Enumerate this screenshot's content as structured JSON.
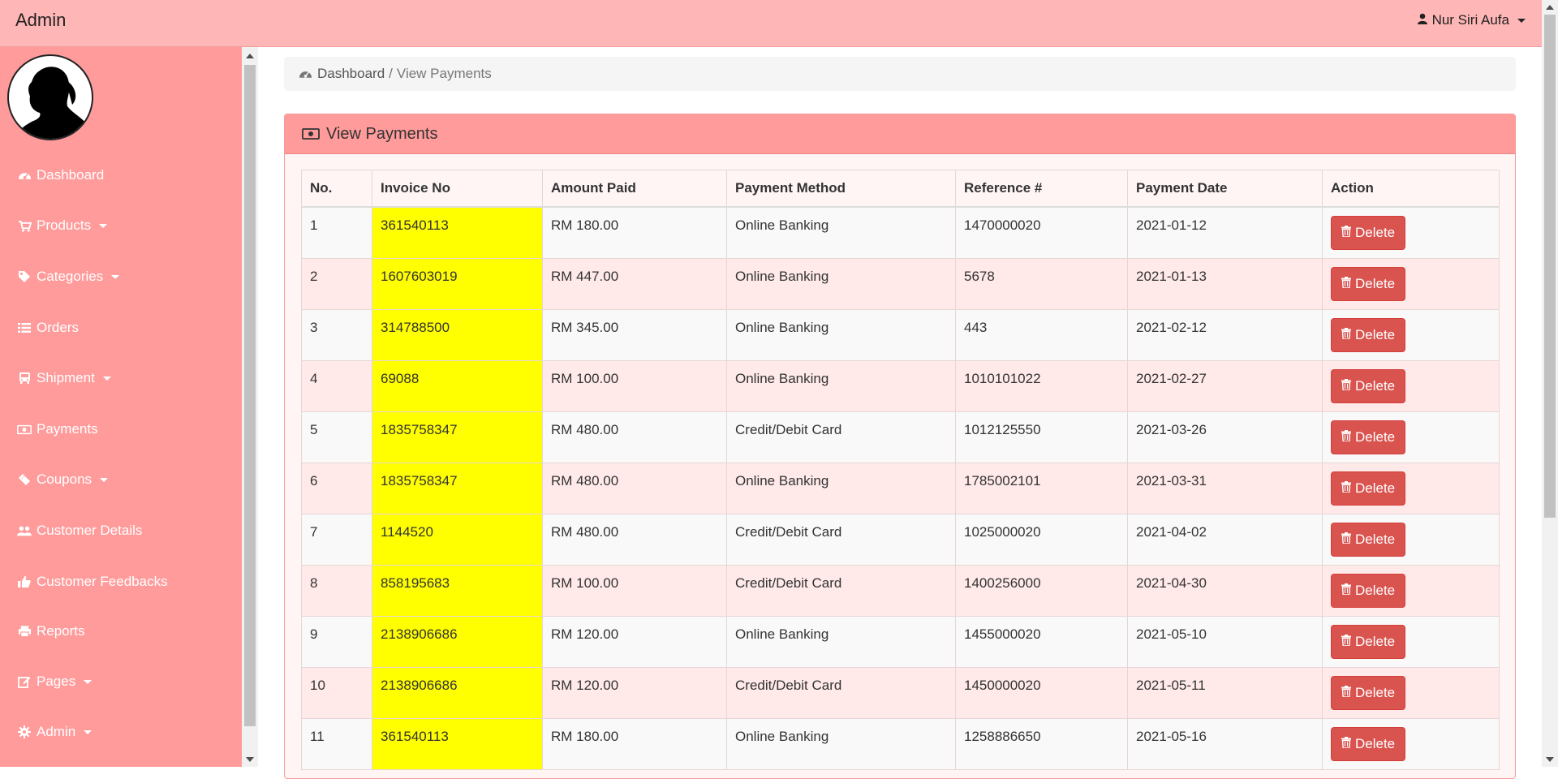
{
  "navbar": {
    "brand": "Admin",
    "user_name": "Nur Siri Aufa"
  },
  "sidebar": {
    "items": [
      {
        "label": "Dashboard",
        "icon": "dashboard-icon",
        "dropdown": false
      },
      {
        "label": "Products",
        "icon": "cart-icon",
        "dropdown": true
      },
      {
        "label": "Categories",
        "icon": "tag-icon",
        "dropdown": true
      },
      {
        "label": "Orders",
        "icon": "list-icon",
        "dropdown": false
      },
      {
        "label": "Shipment",
        "icon": "bus-icon",
        "dropdown": true
      },
      {
        "label": "Payments",
        "icon": "money-icon",
        "dropdown": false
      },
      {
        "label": "Coupons",
        "icon": "ticket-icon",
        "dropdown": true
      },
      {
        "label": "Customer Details",
        "icon": "users-icon",
        "dropdown": false
      },
      {
        "label": "Customer Feedbacks",
        "icon": "thumbs-up-icon",
        "dropdown": false
      },
      {
        "label": "Reports",
        "icon": "print-icon",
        "dropdown": false
      },
      {
        "label": "Pages",
        "icon": "edit-icon",
        "dropdown": true
      },
      {
        "label": "Admin",
        "icon": "gear-icon",
        "dropdown": true
      }
    ]
  },
  "breadcrumb": {
    "root": "Dashboard",
    "separator": "/",
    "current": "View Payments"
  },
  "panel": {
    "title": "View Payments"
  },
  "table": {
    "headers": [
      "No.",
      "Invoice No",
      "Amount Paid",
      "Payment Method",
      "Reference #",
      "Payment Date",
      "Action"
    ],
    "delete_label": "Delete",
    "rows": [
      [
        "1",
        "361540113",
        "RM 180.00",
        "Online Banking",
        "1470000020",
        "2021-01-12"
      ],
      [
        "2",
        "1607603019",
        "RM 447.00",
        "Online Banking",
        "5678",
        "2021-01-13"
      ],
      [
        "3",
        "314788500",
        "RM 345.00",
        "Online Banking",
        "443",
        "2021-02-12"
      ],
      [
        "4",
        "69088",
        "RM 100.00",
        "Online Banking",
        "1010101022",
        "2021-02-27"
      ],
      [
        "5",
        "1835758347",
        "RM 480.00",
        "Credit/Debit Card",
        "1012125550",
        "2021-03-26"
      ],
      [
        "6",
        "1835758347",
        "RM 480.00",
        "Online Banking",
        "1785002101",
        "2021-03-31"
      ],
      [
        "7",
        "1144520",
        "RM 480.00",
        "Credit/Debit Card",
        "1025000020",
        "2021-04-02"
      ],
      [
        "8",
        "858195683",
        "RM 100.00",
        "Credit/Debit Card",
        "1400256000",
        "2021-04-30"
      ],
      [
        "9",
        "2138906686",
        "RM 120.00",
        "Online Banking",
        "1455000020",
        "2021-05-10"
      ],
      [
        "10",
        "2138906686",
        "RM 120.00",
        "Credit/Debit Card",
        "1450000020",
        "2021-05-11"
      ],
      [
        "11",
        "361540113",
        "RM 180.00",
        "Online Banking",
        "1258886650",
        "2021-05-16"
      ]
    ]
  },
  "colors": {
    "navbar_bg": "#ffb6b6",
    "sidebar_bg": "#ff9b9b",
    "panel_heading_bg": "#ff9b9b",
    "invoice_highlight": "#ffff00",
    "delete_button": "#d9534f"
  }
}
